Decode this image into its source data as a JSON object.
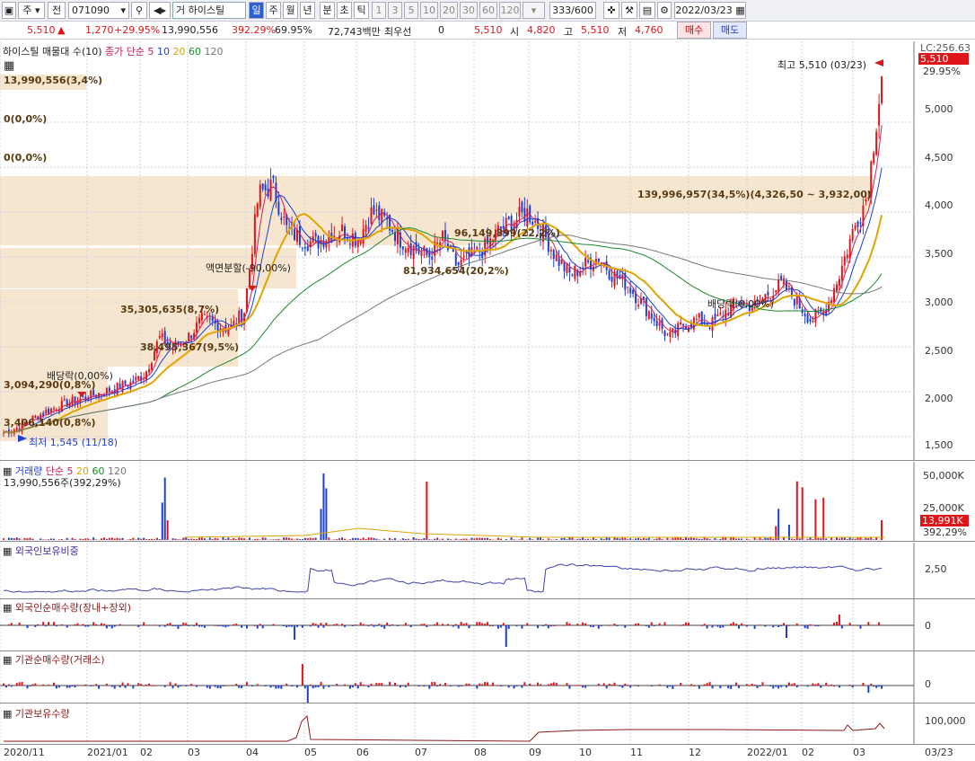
{
  "toolbar": {
    "market": "주",
    "chart_mode": "전",
    "code": "071090",
    "prefix": "거",
    "name": "하이스틸",
    "periods": [
      "일",
      "주",
      "월",
      "년",
      "분",
      "초",
      "틱"
    ],
    "numbers": [
      "1",
      "3",
      "5",
      "10",
      "20",
      "30",
      "60",
      "120"
    ],
    "count": "333/600",
    "date": "2022/03/23"
  },
  "info": {
    "price": "5,510",
    "change": "1,270",
    "change_pct": "+29.95%",
    "volume": "13,990,556",
    "vol_ratio": "392.29%",
    "turnover": "69.95%",
    "amount": "72,743백만",
    "best_label": "최우선",
    "best_val": "0",
    "best_price": "5,510",
    "open_label": "시",
    "open": "4,820",
    "high_label": "고",
    "high": "5,510",
    "low_label": "저",
    "low": "4,760",
    "buy": "매수",
    "sell": "매도"
  },
  "price_panel": {
    "title": "하이스틸 매물대 수(10)",
    "ma_label": "종가 단순",
    "ma_periods": [
      "5",
      "10",
      "20",
      "60",
      "120"
    ],
    "ma_colors": [
      "#d81b60",
      "#1a3fd4",
      "#e0a300",
      "#1a8a2a",
      "#777777"
    ],
    "lc": "LC:256.63",
    "last_price": "5,510",
    "last_pct": "29.95%",
    "high_note": "최고 5,510 (03/23)",
    "low_note": "최저 1,545 (11/18)",
    "split_note": "액면분할(-90,00%)",
    "div_note1": "배당락(0,00%)",
    "div_note2": "배당락(0,00%)",
    "profile_labels": [
      "13,990,556(3,4%)",
      "0(0,0%)",
      "0(0,0%)",
      "139,996,957(34,5%)(4,326,50 ~ 3,932,00)",
      "96,149,899(22,2%)",
      "81,934,654(20,2%)",
      "35,305,635(8,7%)",
      "38,495,367(9,5%)",
      "3,094,290(0,8%)",
      "3,406,140(0,8%)"
    ],
    "y_ticks": [
      "5,000",
      "4,500",
      "4,000",
      "3,500",
      "3,000",
      "2,500",
      "2,000",
      "1,500"
    ]
  },
  "volume_panel": {
    "title": "거래량",
    "ma_label": "단순",
    "ma_periods": [
      "5",
      "20",
      "60",
      "120"
    ],
    "value": "13,990,556주(392,29%)",
    "y_ticks": [
      "50,000K",
      "25,000K"
    ],
    "last": "13,991K",
    "last_pct": "392,29%"
  },
  "foreign_hold": {
    "title": "외국인보유비중",
    "y_tick": "2,50"
  },
  "foreign_net": {
    "title": "외국인순매수량(장내+장외)",
    "y_tick": "0"
  },
  "inst_net": {
    "title": "기관순매수량(거래소)",
    "y_tick": "0"
  },
  "inst_hold": {
    "title": "기관보유수량",
    "y_tick": "100,000"
  },
  "x_axis": [
    "2020/11",
    "2021/01",
    "02",
    "03",
    "04",
    "05",
    "06",
    "07",
    "08",
    "09",
    "10",
    "11",
    "12",
    "2022/01",
    "02",
    "03"
  ],
  "x_end": "03/23",
  "chart_data": {
    "type": "candlestick",
    "y_range": [
      1400,
      5600
    ],
    "close_path": [
      1545,
      1600,
      1700,
      1780,
      1850,
      1900,
      1950,
      1990,
      2050,
      2100,
      2200,
      2600,
      2500,
      2600,
      2800,
      2750,
      2700,
      2900,
      4200,
      4300,
      3800,
      3700,
      3650,
      3750,
      3800,
      3700,
      4000,
      3900,
      3700,
      3600,
      3500,
      3700,
      3400,
      3500,
      3600,
      3800,
      3900,
      4000,
      3800,
      3500,
      3300,
      3400,
      3500,
      3300,
      3200,
      3000,
      2800,
      2600,
      2750,
      2800,
      2750,
      2900,
      3000,
      2950,
      3100,
      3200,
      3000,
      2800,
      2900,
      3300,
      3800,
      4200,
      5510
    ]
  }
}
